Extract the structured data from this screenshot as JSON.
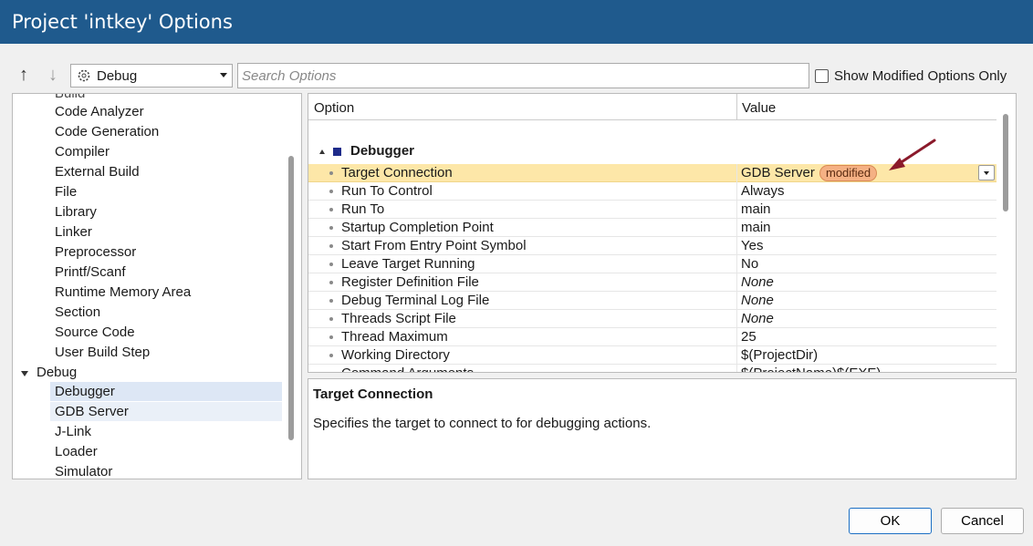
{
  "window": {
    "title": "Project 'intkey' Options"
  },
  "toolbar": {
    "up_icon": "arrow-up-icon",
    "down_icon": "arrow-down-icon",
    "configuration": "Debug",
    "search_placeholder": "Search Options",
    "show_modified_label": "Show Modified Options Only",
    "show_modified_checked": false
  },
  "tree": {
    "partial_top": "Build",
    "items": [
      {
        "label": "Code Analyzer"
      },
      {
        "label": "Code Generation"
      },
      {
        "label": "Compiler"
      },
      {
        "label": "External Build"
      },
      {
        "label": "File"
      },
      {
        "label": "Library"
      },
      {
        "label": "Linker"
      },
      {
        "label": "Preprocessor"
      },
      {
        "label": "Printf/Scanf"
      },
      {
        "label": "Runtime Memory Area"
      },
      {
        "label": "Section"
      },
      {
        "label": "Source Code"
      },
      {
        "label": "User Build Step"
      }
    ],
    "debug_group": "Debug",
    "debug_items": [
      {
        "label": "Debugger"
      },
      {
        "label": "GDB Server"
      },
      {
        "label": "J-Link"
      },
      {
        "label": "Loader"
      },
      {
        "label": "Simulator"
      }
    ]
  },
  "grid": {
    "col_option": "Option",
    "col_value": "Value",
    "group": "Debugger",
    "rows": [
      {
        "name": "Target Connection",
        "value": "GDB Server",
        "badge": "modified"
      },
      {
        "name": "Run To Control",
        "value": "Always"
      },
      {
        "name": "Run To",
        "value": "main"
      },
      {
        "name": "Startup Completion Point",
        "value": "main"
      },
      {
        "name": "Start From Entry Point Symbol",
        "value": "Yes"
      },
      {
        "name": "Leave Target Running",
        "value": "No"
      },
      {
        "name": "Register Definition File",
        "value": "None"
      },
      {
        "name": "Debug Terminal Log File",
        "value": "None"
      },
      {
        "name": "Threads Script File",
        "value": "None"
      },
      {
        "name": "Thread Maximum",
        "value": "25"
      },
      {
        "name": "Working Directory",
        "value": "$(ProjectDir)"
      },
      {
        "name": "Command Arguments",
        "value": "$(ProjectName)$(EXE)"
      }
    ],
    "annotation_color": "#8b1a2b"
  },
  "description": {
    "title": "Target Connection",
    "text": "Specifies the target to connect to for debugging actions."
  },
  "buttons": {
    "ok": "OK",
    "cancel": "Cancel"
  }
}
